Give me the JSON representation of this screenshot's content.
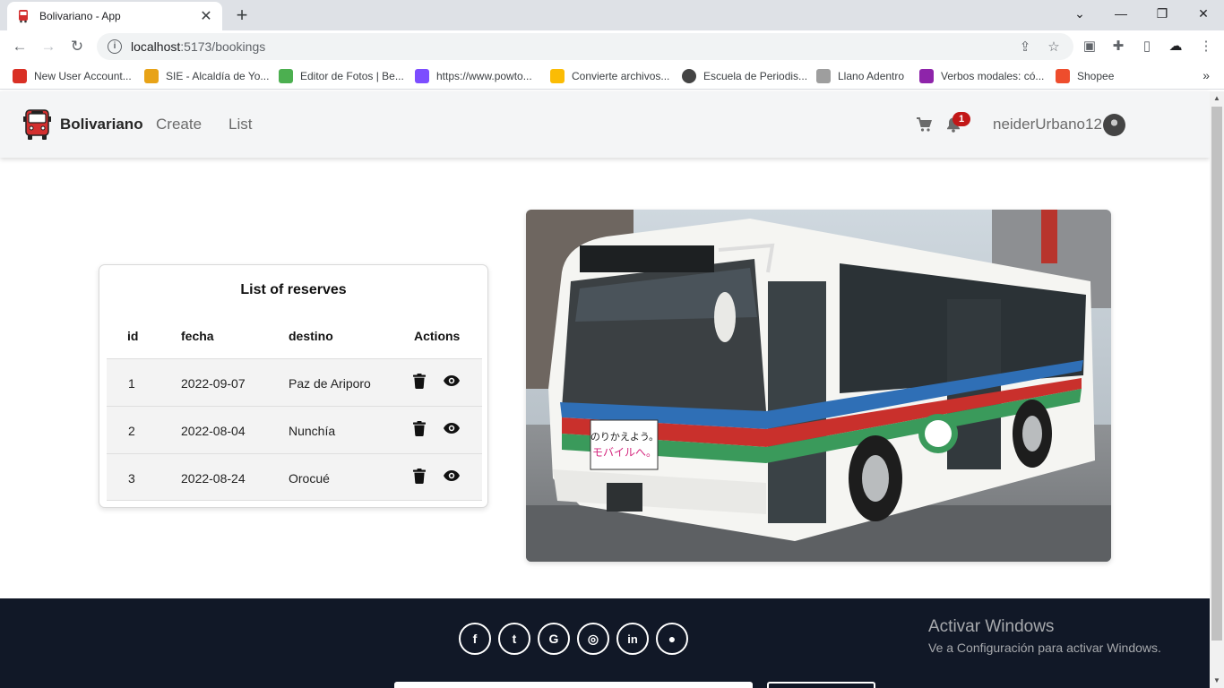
{
  "browser": {
    "tab_title": "Bolivariano - App",
    "url_host": "localhost",
    "url_path": ":5173/bookings",
    "bookmarks": [
      {
        "label": "New User Account...",
        "color": "#d93025"
      },
      {
        "label": "SIE - Alcaldía de Yo...",
        "color": "#e8a317"
      },
      {
        "label": "Editor de Fotos | Be...",
        "color": "#4caf50"
      },
      {
        "label": "https://www.powto...",
        "color": "#7c4dff"
      },
      {
        "label": "Convierte archivos...",
        "color": "#fbbc04"
      },
      {
        "label": "Escuela de Periodis...",
        "color": "#444444"
      },
      {
        "label": "Llano Adentro",
        "color": "#9e9e9e"
      },
      {
        "label": "Verbos modales: có...",
        "color": "#8e24aa"
      },
      {
        "label": "Shopee",
        "color": "#ee4d2d"
      }
    ]
  },
  "navbar": {
    "brand": "Bolivariano",
    "links": [
      "Create",
      "List"
    ],
    "notification_count": "1",
    "username": "neiderUrbano12"
  },
  "reserves": {
    "title": "List of reserves",
    "columns": [
      "id",
      "fecha",
      "destino",
      "Actions"
    ],
    "rows": [
      {
        "id": "1",
        "fecha": "2022-09-07",
        "destino": "Paz de Ariporo"
      },
      {
        "id": "2",
        "fecha": "2022-08-04",
        "destino": "Nunchía"
      },
      {
        "id": "3",
        "fecha": "2022-08-24",
        "destino": "Orocué"
      }
    ]
  },
  "bus_sign": {
    "line1": "のりかえよう。",
    "line2": "モバイルへ。"
  },
  "footer": {
    "social": [
      {
        "icon": "facebook-icon",
        "glyph": "f"
      },
      {
        "icon": "twitter-icon",
        "glyph": "t"
      },
      {
        "icon": "google-icon",
        "glyph": "G"
      },
      {
        "icon": "instagram-icon",
        "glyph": "◎"
      },
      {
        "icon": "linkedin-icon",
        "glyph": "in"
      },
      {
        "icon": "github-icon",
        "glyph": "●"
      }
    ]
  },
  "watermark": {
    "title": "Activar Windows",
    "subtitle": "Ve a Configuración para activar Windows."
  },
  "colors": {
    "navbar_bg": "#f4f5f6",
    "footer_bg": "#111827",
    "badge": "#c21717",
    "brand_logo": "#d32f2f"
  }
}
